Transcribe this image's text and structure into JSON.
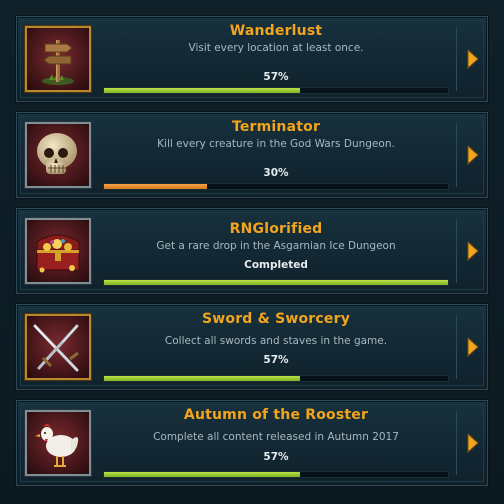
{
  "colors": {
    "title": "#f2a51c",
    "progress_green": "#9ccc34",
    "progress_orange": "#e88a2a",
    "frame_gold": "#b88a2a",
    "frame_silver": "#7f8f96"
  },
  "achievements": [
    {
      "title": "Wanderlust",
      "description": "Visit every location at least once.",
      "status": "57%",
      "progress": 0.57,
      "bar_color": "green",
      "icon": "signpost-icon",
      "frame": "gold"
    },
    {
      "title": "Terminator",
      "description": "Kill every creature in the God Wars Dungeon.",
      "status": "30%",
      "progress": 0.3,
      "bar_color": "orange",
      "icon": "skull-icon",
      "frame": "silver"
    },
    {
      "title": "RNGlorified",
      "description": "Get a rare drop in the Asgarnian Ice Dungeon",
      "status": "Completed",
      "progress": 1.0,
      "bar_color": "green",
      "icon": "treasure-chest-icon",
      "frame": "silver"
    },
    {
      "title": "Sword & Sworcery",
      "description": "Collect all swords and staves in the game.",
      "status": "57%",
      "progress": 0.57,
      "bar_color": "green",
      "icon": "crossed-swords-icon",
      "frame": "gold"
    },
    {
      "title": "Autumn of the Rooster",
      "description": "Complete all content released in Autumn 2017",
      "status": "57%",
      "progress": 0.57,
      "bar_color": "green",
      "icon": "rooster-icon",
      "frame": "silver"
    }
  ]
}
